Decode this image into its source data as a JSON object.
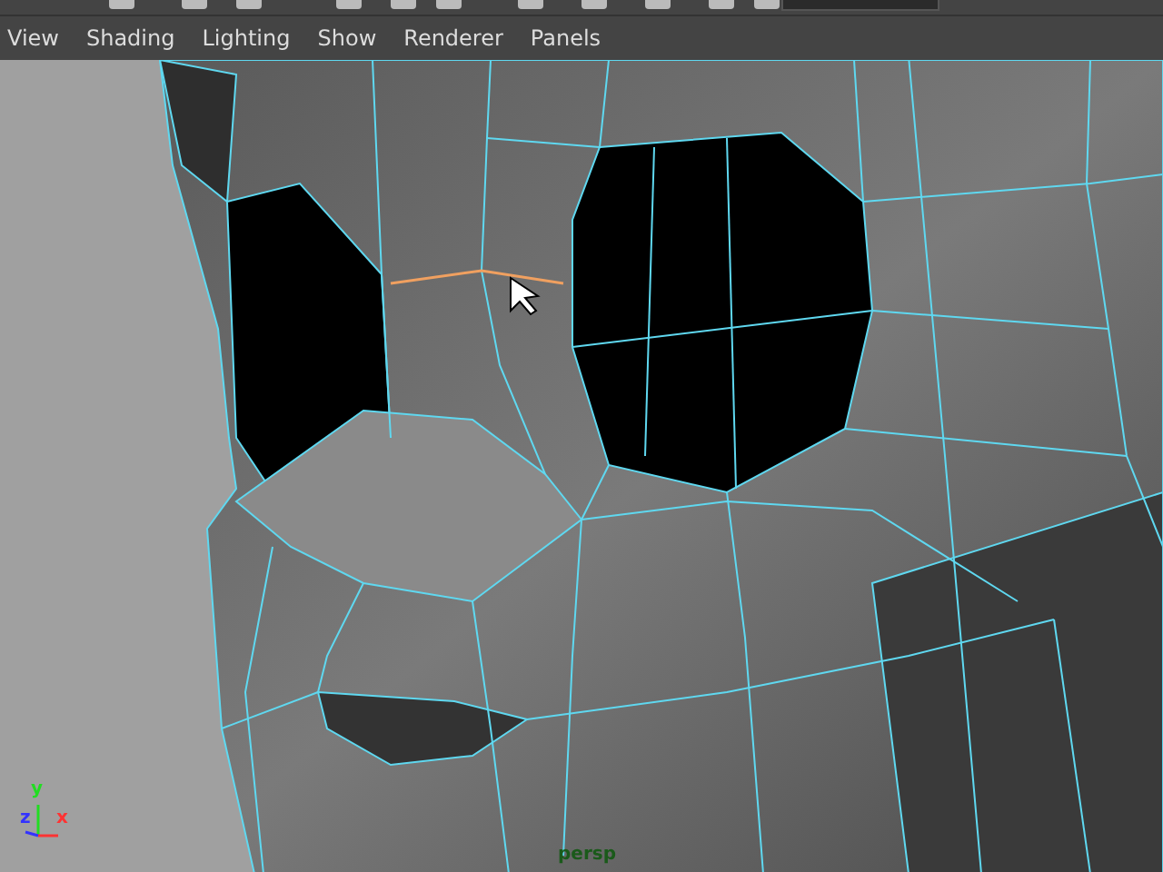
{
  "menu_bar": {
    "items": [
      "View",
      "Shading",
      "Lighting",
      "Show",
      "Renderer",
      "Panels"
    ]
  },
  "viewport": {
    "camera_label": "persp",
    "axes": [
      "y",
      "z",
      "x"
    ]
  }
}
